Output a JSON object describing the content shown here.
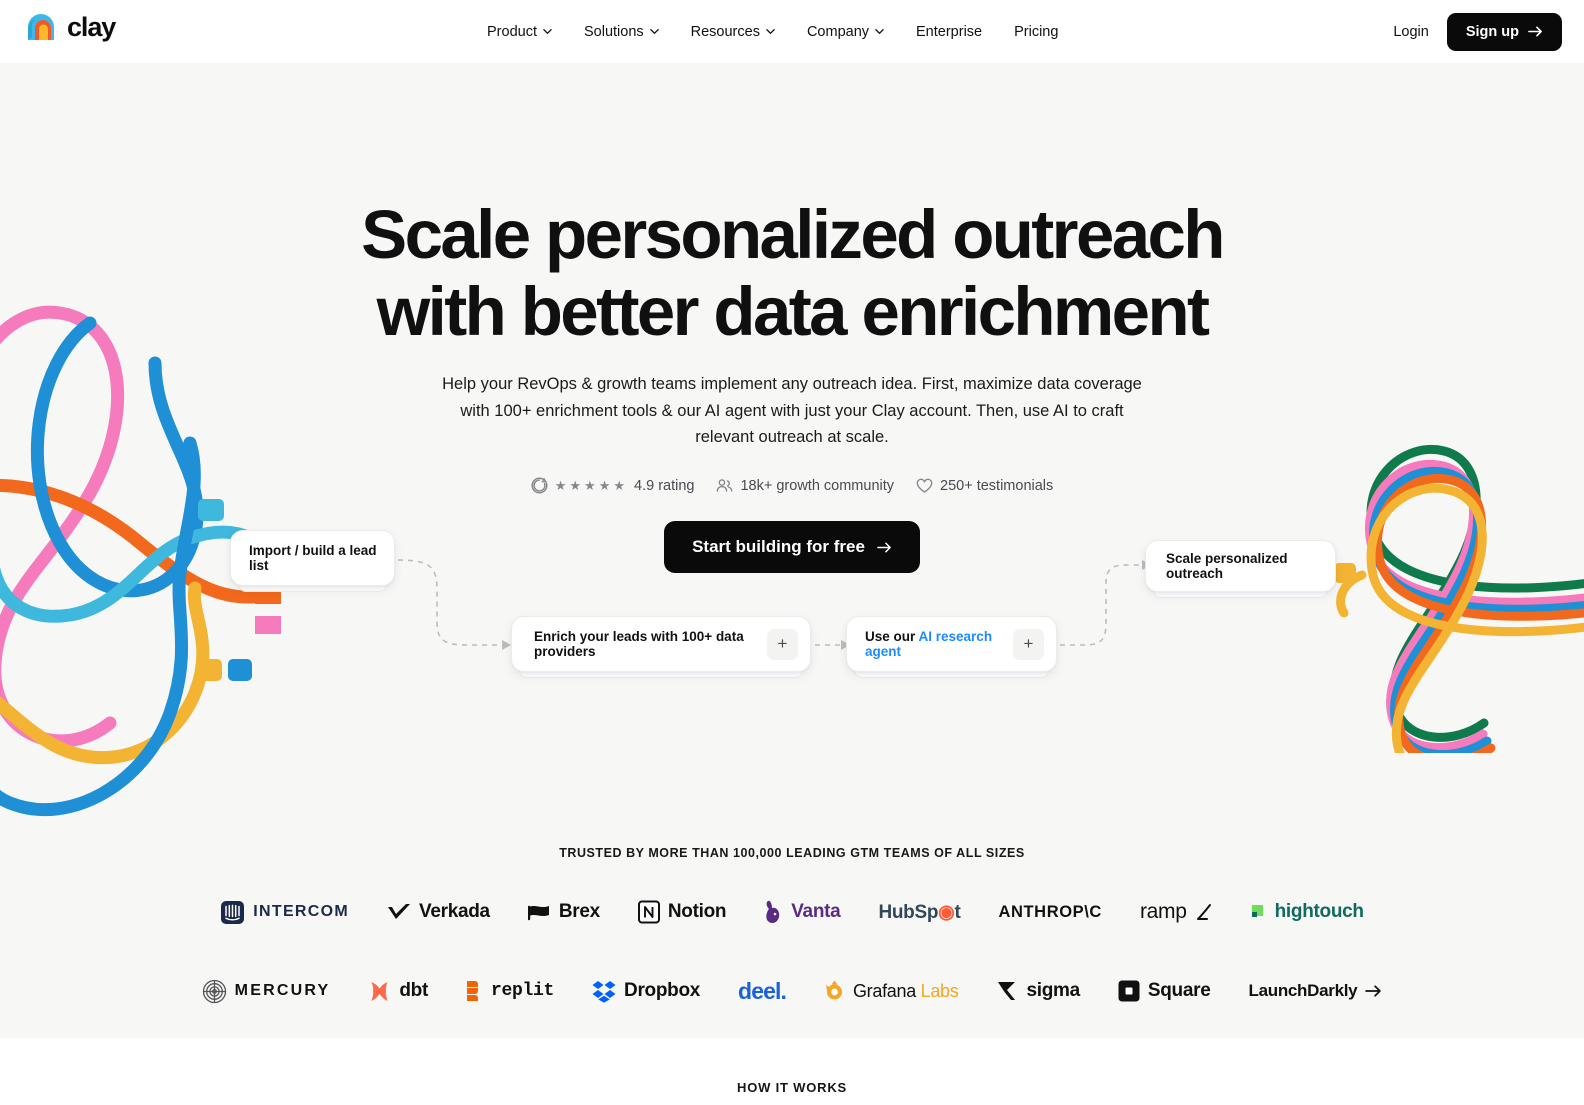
{
  "header": {
    "logo_text": "clay",
    "logo_icon": "clay-arch-logo",
    "nav": [
      {
        "label": "Product",
        "has_dropdown": true,
        "icon": "chevron-down-icon"
      },
      {
        "label": "Solutions",
        "has_dropdown": true,
        "icon": "chevron-down-icon"
      },
      {
        "label": "Resources",
        "has_dropdown": true,
        "icon": "chevron-down-icon"
      },
      {
        "label": "Company",
        "has_dropdown": true,
        "icon": "chevron-down-icon"
      },
      {
        "label": "Enterprise",
        "has_dropdown": false,
        "icon": ""
      },
      {
        "label": "Pricing",
        "has_dropdown": false,
        "icon": ""
      }
    ],
    "login_label": "Login",
    "signup_label": "Sign up",
    "signup_icon": "arrow-right-icon"
  },
  "hero": {
    "headline_line1": "Scale personalized outreach",
    "headline_line2": "with better data enrichment",
    "subhead": "Help your RevOps & growth teams implement any outreach idea. First, maximize data coverage with 100+ enrichment tools & our AI agent with just your Clay account. Then, use AI to craft relevant outreach at scale.",
    "proof": {
      "g2_icon": "g2-logo-icon",
      "star_glyph": "★",
      "star_count": 5,
      "rating_label": "4.9 rating",
      "community_icon": "people-icon",
      "community_label": "18k+ growth community",
      "testimonials_icon": "heart-icon",
      "testimonials_label": "250+ testimonials"
    },
    "cta_label": "Start building for free",
    "cta_icon": "arrow-right-icon"
  },
  "flow": {
    "cards": [
      {
        "label": "Import / build a lead list",
        "plus": ""
      },
      {
        "label": "Enrich your leads with 100+ data providers",
        "plus": "+"
      },
      {
        "label_prefix": "Use our ",
        "label_link": "AI research agent",
        "plus": "+"
      },
      {
        "label": "Scale personalized outreach",
        "plus": ""
      }
    ]
  },
  "trusted": {
    "label": "TRUSTED BY MORE THAN 100,000 LEADING GTM TEAMS OF ALL SIZES",
    "row1": [
      {
        "name": "INTERCOM",
        "icon": "intercom-icon"
      },
      {
        "name": "Verkada",
        "icon": "verkada-check-icon"
      },
      {
        "name": "Brex",
        "icon": "brex-flag-icon"
      },
      {
        "name": "Notion",
        "icon": "notion-icon"
      },
      {
        "name": "Vanta",
        "icon": "vanta-rabbit-icon"
      },
      {
        "name": "HubSpot",
        "icon": "hubspot-sprocket-icon"
      },
      {
        "name": "ANTHROP\\C",
        "icon": ""
      },
      {
        "name": "ramp",
        "icon": "ramp-icon"
      },
      {
        "name": "hightouch",
        "icon": "hightouch-square-icon"
      }
    ],
    "row2": [
      {
        "name": "MERCURY",
        "icon": "mercury-orb-icon"
      },
      {
        "name": "dbt",
        "icon": "dbt-x-icon"
      },
      {
        "name": "replit",
        "icon": "replit-icon"
      },
      {
        "name": "Dropbox",
        "icon": "dropbox-icon"
      },
      {
        "name": "deel.",
        "icon": ""
      },
      {
        "name": "Grafana Labs",
        "icon": "grafana-icon"
      },
      {
        "name": "sigma",
        "icon": "sigma-icon"
      },
      {
        "name": "Square",
        "icon": "square-icon"
      },
      {
        "name": "LaunchDarkly",
        "icon": "arrow-right-icon"
      }
    ]
  },
  "bottom": {
    "section_label": "HOW IT WORKS"
  },
  "colors": {
    "page_bg": "#f7f7f6",
    "header_bg": "#ffffff",
    "accent_dark": "#0a0a0a",
    "link_blue": "#1a8cff",
    "cable_pink": "#f57bbd",
    "cable_blue": "#1f8fd6",
    "cable_orange": "#f2681c",
    "cable_cyan": "#3fb8dd",
    "cable_yellow": "#f3b433",
    "cable_green": "#0f7a4b"
  }
}
